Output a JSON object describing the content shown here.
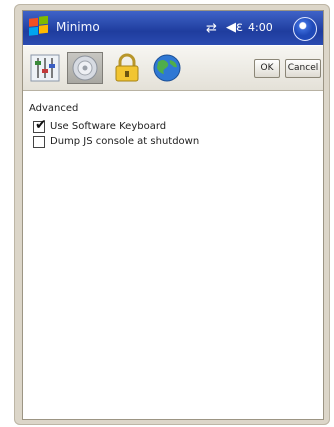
{
  "titlebar": {
    "title": "Minimo",
    "time": "4:00",
    "connectivity_icon": "⇄",
    "volume_icon": "◀ε"
  },
  "toolbar": {
    "tabs": [
      {
        "name": "sliders",
        "selected": false
      },
      {
        "name": "disc",
        "selected": true
      },
      {
        "name": "lock",
        "selected": false
      },
      {
        "name": "globe",
        "selected": false
      }
    ],
    "ok_label": "OK",
    "cancel_label": "Cancel"
  },
  "settings": {
    "section_title": "Advanced",
    "options": [
      {
        "label": "Use Software Keyboard",
        "checked": true
      },
      {
        "label": "Dump JS console at shutdown",
        "checked": false
      }
    ]
  }
}
